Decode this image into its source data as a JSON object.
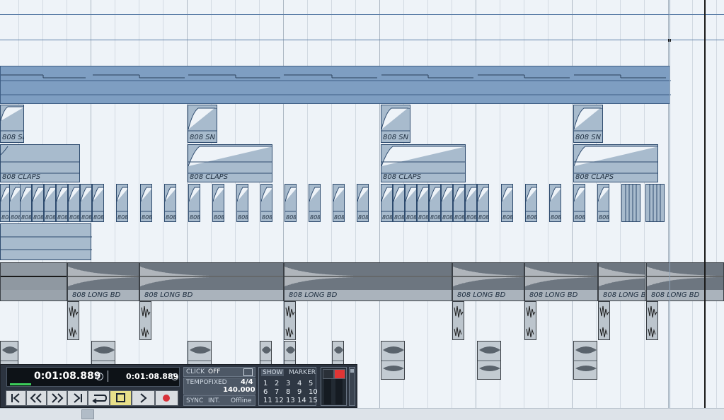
{
  "parts": {
    "snare_label": "808 SN",
    "claps_label": "808 CLAPS",
    "hat_label": "808",
    "kick_label": "808 LONG BD",
    "kick_short_label": "808 LONG B"
  },
  "transport": {
    "primary_time": "0:01:08.889",
    "secondary_time": "0:01:08.889",
    "click_label": "CLICK",
    "click_value": "OFF",
    "tempo_label": "TEMPO",
    "tempo_mode": "FIXED",
    "signature": "4/4",
    "tempo_value": "140.000",
    "sync_label": "SYNC",
    "sync_mode": "INT.",
    "sync_status": "Offline",
    "show_label": "SHOW",
    "marker_label": "MARKER",
    "markers_row1": [
      "1",
      "2",
      "3",
      "4",
      "5"
    ],
    "markers_row2": [
      "6",
      "7",
      "8",
      "9",
      "10"
    ],
    "markers_row3": [
      "11",
      "12",
      "13",
      "14",
      "15"
    ],
    "plus_label": "+",
    "minus_label": "-",
    "icons": {
      "to_start": "to-start-icon",
      "rewind": "rewind-icon",
      "forward": "fast-forward-icon",
      "to_end": "to-end-icon",
      "cycle": "cycle-icon",
      "stop": "stop-icon",
      "play": "play-icon",
      "record": "record-icon"
    },
    "colors": {
      "record": "#d8323a",
      "stop_bg": "#e8e08a",
      "level_green": "#3ccb5a",
      "meter_red": "#e03535"
    }
  }
}
